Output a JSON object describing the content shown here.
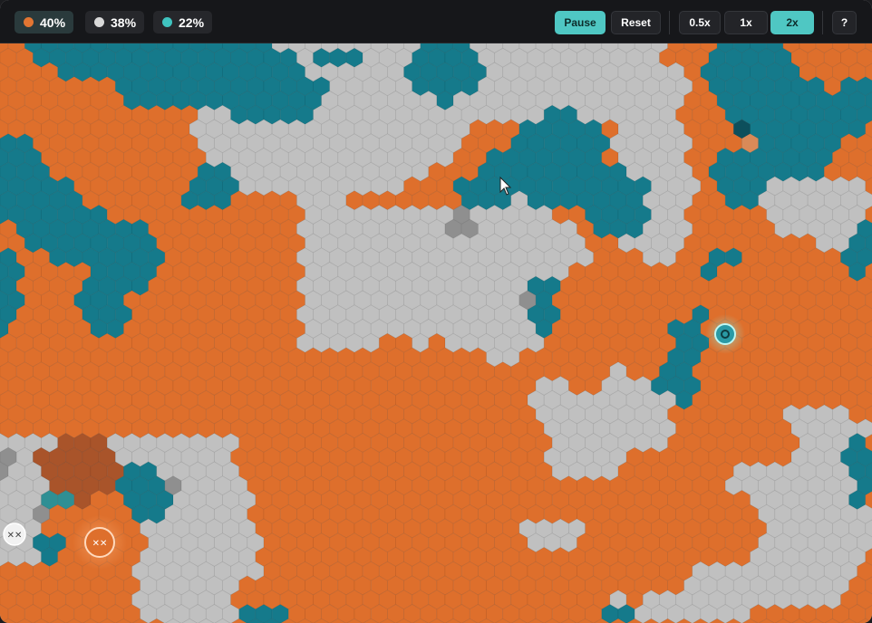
{
  "stats": [
    {
      "name": "orange",
      "label": "40%",
      "color": "#e27532"
    },
    {
      "name": "gray",
      "label": "38%",
      "color": "#d9d9d9"
    },
    {
      "name": "teal",
      "label": "22%",
      "color": "#3fc3bf"
    }
  ],
  "controls": {
    "pause_label": "Pause",
    "reset_label": "Reset",
    "speed_half_label": "0.5x",
    "speed_1_label": "1x",
    "speed_2_label": "2x",
    "help_label": "?"
  },
  "palette": {
    "orange": "#de6f2c",
    "teal": "#157a8b",
    "gray": "#c0c0c0",
    "dark_orange": "#a9542a",
    "dark_gray": "#8f8f8f",
    "accent": "#4fc7c3"
  },
  "units": [
    {
      "name": "orange-unit",
      "label": "✕✕",
      "color": "#de6f2c"
    },
    {
      "name": "gray-unit",
      "label": "✕✕",
      "color": "#e6e6e6"
    },
    {
      "name": "teal-unit",
      "label": "◎",
      "color": "#2a9aa5"
    }
  ]
}
